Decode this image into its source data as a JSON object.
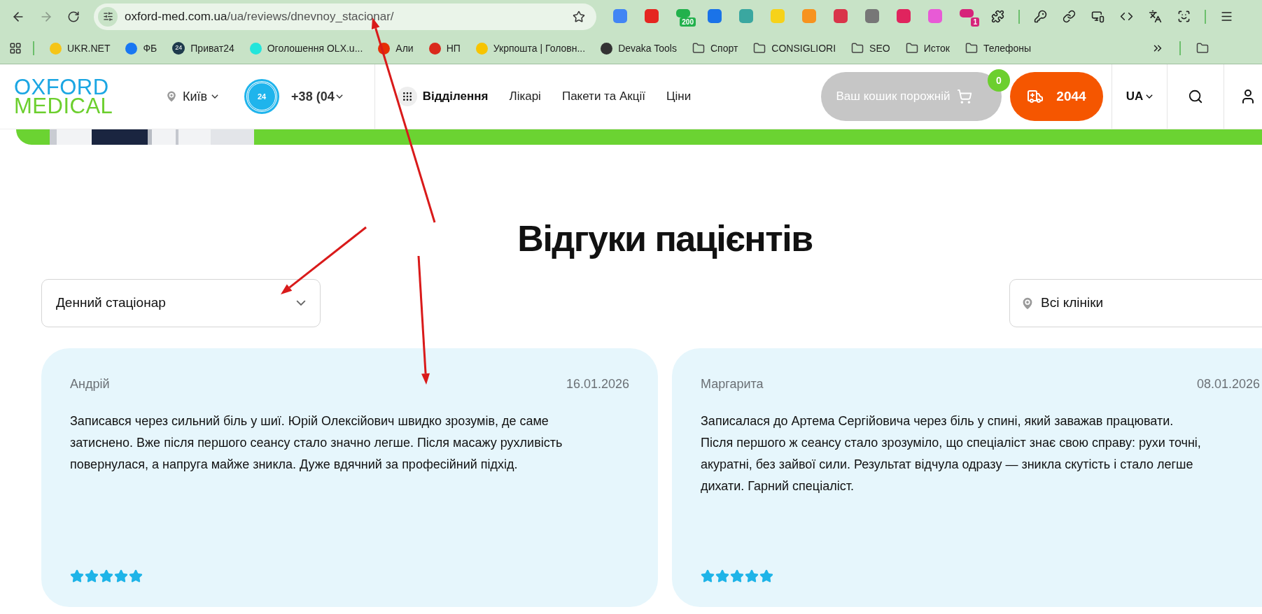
{
  "address_bar": {
    "domain": "oxford-med.com.ua",
    "path": "/ua/reviews/dnevnoy_stacionar/"
  },
  "extensions": [
    {
      "color": "#4285f4"
    },
    {
      "color": "#e52620"
    },
    {
      "color": "#22b14c",
      "badge": "200"
    },
    {
      "color": "#1a73e8"
    },
    {
      "color": "#3aa7a0"
    },
    {
      "color": "#f6d21a"
    },
    {
      "color": "#f7931e"
    },
    {
      "color": "#d9344a"
    },
    {
      "color": "#777777"
    },
    {
      "color": "#e0245e"
    },
    {
      "color": "#e85ad6"
    },
    {
      "color": "#d6247a",
      "badge": "1"
    }
  ],
  "bookmarks": [
    {
      "kind": "site",
      "label": "UKR.NET",
      "color": "#f5c518"
    },
    {
      "kind": "site",
      "label": "ФБ",
      "color": "#1877f2"
    },
    {
      "kind": "site",
      "label": "Приват24",
      "color": "#1e3a4c",
      "icon_text": "24"
    },
    {
      "kind": "site",
      "label": "Оголошення OLX.u...",
      "color": "#23e5db"
    },
    {
      "kind": "site",
      "label": "Али",
      "color": "#e62e04"
    },
    {
      "kind": "site",
      "label": "НП",
      "color": "#da291c"
    },
    {
      "kind": "site",
      "label": "Укрпошта | Головн...",
      "color": "#f7c400"
    },
    {
      "kind": "site",
      "label": "Devaka Tools",
      "color": "#333333"
    },
    {
      "kind": "folder",
      "label": "Спорт"
    },
    {
      "kind": "folder",
      "label": "CONSIGLIORI"
    },
    {
      "kind": "folder",
      "label": "SEO"
    },
    {
      "kind": "folder",
      "label": "Исток"
    },
    {
      "kind": "folder",
      "label": "Телефоны"
    }
  ],
  "header": {
    "logo_top": "OXFORD",
    "logo_bottom": "MEDICAL",
    "city": "Київ",
    "phone_icon_text": "24",
    "phone": "+38 (04",
    "nav": [
      {
        "label": "Відділення",
        "selected": true
      },
      {
        "label": "Лікарі",
        "selected": false
      },
      {
        "label": "Пакети та Акції",
        "selected": false
      },
      {
        "label": "Ціни",
        "selected": false
      }
    ],
    "cart": {
      "label": "Ваш кошик порожній",
      "count": "0"
    },
    "hotline": "2044",
    "language": "UA"
  },
  "page": {
    "title": "Відгуки пацієнтів",
    "department_select": "Денний стаціонар",
    "clinic_select": "Всі клініки"
  },
  "reviews": [
    {
      "author": "Андрій",
      "date": "16.01.2026",
      "text": "Записався через сильний біль у шиї. Юрій Олексійович швидко зрозумів, де саме затиснено. Вже після першого сеансу стало значно легше. Після масажу рухливість повернулася, а напруга майже зникла. Дуже вдячний за професійний підхід.",
      "stars": 5
    },
    {
      "author": "Маргарита",
      "date": "08.01.2026",
      "text": "Записалася до Артема Сергійовича через біль у спині, який заважав працювати. Після першого ж сеансу стало зрозуміло, що спеціаліст знає свою справу: рухи точні, акуратні, без зайвої сили. Результат відчула одразу — зникла скутість і стало легше дихати. Гарний спеціаліст.",
      "stars": 5
    }
  ]
}
